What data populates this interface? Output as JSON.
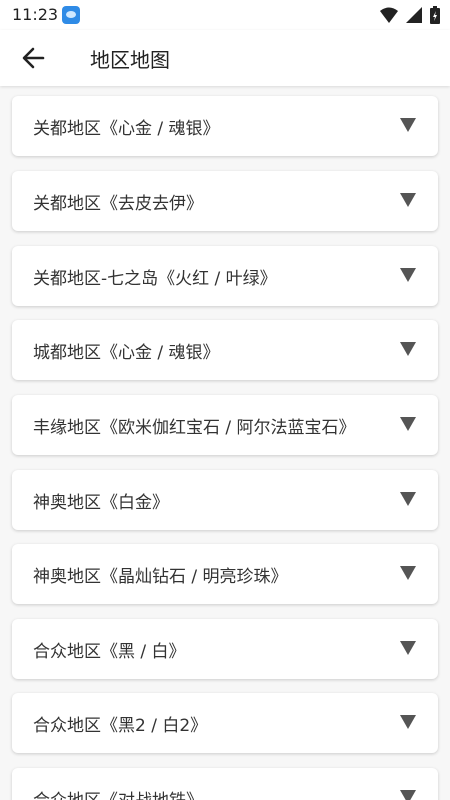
{
  "status_bar": {
    "time": "11:23"
  },
  "header": {
    "title": "地区地图"
  },
  "regions": [
    {
      "label": "关都地区《心金 / 魂银》"
    },
    {
      "label": "关都地区《去皮去伊》"
    },
    {
      "label": "关都地区-七之岛《火红 / 叶绿》"
    },
    {
      "label": "城都地区《心金 / 魂银》"
    },
    {
      "label": "丰缘地区《欧米伽红宝石 / 阿尔法蓝宝石》"
    },
    {
      "label": "神奥地区《白金》"
    },
    {
      "label": "神奥地区《晶灿钻石 / 明亮珍珠》"
    },
    {
      "label": "合众地区《黑 / 白》"
    },
    {
      "label": "合众地区《黑2 / 白2》"
    },
    {
      "label": "合众地区《对战地铁》"
    }
  ],
  "icons": {
    "back": "arrow-left-icon",
    "expand": "triangle-down-icon",
    "wifi": "wifi-icon",
    "signal": "signal-icon",
    "battery": "battery-icon"
  }
}
